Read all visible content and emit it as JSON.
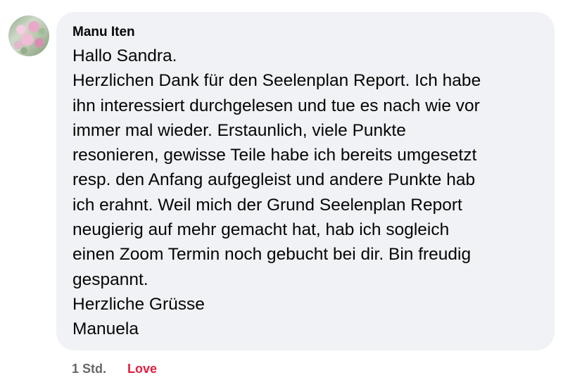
{
  "comment": {
    "author": "Manu Iten",
    "lines": [
      "Hallo Sandra.",
      "Herzlichen Dank für den Seelenplan Report. Ich habe",
      "ihn interessiert durchgelesen und tue es nach wie vor",
      "immer mal wieder. Erstaunlich, viele Punkte",
      "resonieren, gewisse Teile habe ich bereits umgesetzt",
      "resp. den Anfang aufgegleist und andere Punkte hab",
      "ich erahnt. Weil mich der Grund Seelenplan Report",
      "neugierig auf mehr gemacht hat, hab ich sogleich",
      "einen Zoom Termin noch gebucht bei dir. Bin freudig",
      "gespannt.",
      "Herzliche Grüsse",
      "Manuela"
    ],
    "timestamp": "1 Std.",
    "reaction_label": "Love"
  },
  "colors": {
    "bubble_background": "#f0f2f5",
    "text": "#050505",
    "timestamp": "#65676b",
    "reaction_love": "#e41e3f"
  },
  "icons": {
    "avatar": "profile-photo-avatar"
  }
}
